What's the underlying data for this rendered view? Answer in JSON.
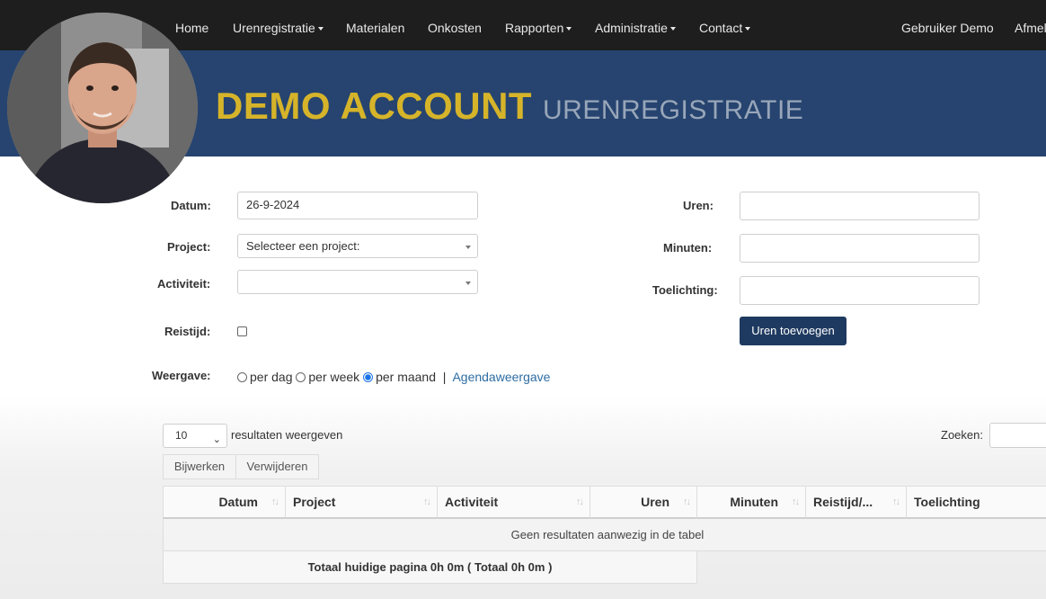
{
  "nav": {
    "home": "Home",
    "urenregistratie": "Urenregistratie",
    "materialen": "Materialen",
    "onkosten": "Onkosten",
    "rapporten": "Rapporten",
    "administratie": "Administratie",
    "contact": "Contact",
    "user": "Gebruiker Demo",
    "logout": "Afmel"
  },
  "banner": {
    "title": "DEMO ACCOUNT",
    "subtitle": "URENREGISTRATIE"
  },
  "form": {
    "datum_label": "Datum:",
    "datum_value": "26-9-2024",
    "project_label": "Project:",
    "project_value": "Selecteer een project:",
    "activiteit_label": "Activiteit:",
    "activiteit_value": "",
    "reistijd_label": "Reistijd:",
    "reistijd_checked": false,
    "weergave_label": "Weergave:",
    "weergave_options": [
      "per dag",
      "per week",
      "per maand"
    ],
    "weergave_selected": "per maand",
    "separator": "|",
    "agenda_link": "Agendaweergave",
    "uren_label": "Uren:",
    "uren_value": "",
    "minuten_label": "Minuten:",
    "minuten_value": "",
    "toelichting_label": "Toelichting:",
    "toelichting_value": "",
    "add_button": "Uren toevoegen"
  },
  "table_controls": {
    "length_value": "10",
    "length_suffix": "resultaten weergeven",
    "update_button": "Bijwerken",
    "delete_button": "Verwijderen",
    "search_label": "Zoeken:"
  },
  "table": {
    "columns": [
      "Datum",
      "Project",
      "Activiteit",
      "Uren",
      "Minuten",
      "Reistijd/...",
      "Toelichting"
    ],
    "empty_message": "Geen resultaten aanwezig in de tabel",
    "total": "Totaal huidige pagina 0h 0m ( Totaal 0h 0m )"
  },
  "colors": {
    "nav_bg": "#1e1e1e",
    "banner_bg": "#26446f",
    "banner_title": "#d6b42a",
    "banner_subtitle": "#98a6b9",
    "primary_button": "#1f3a60",
    "link": "#2d6da3"
  }
}
